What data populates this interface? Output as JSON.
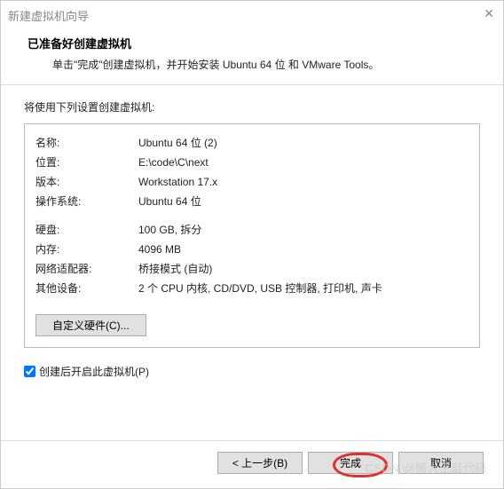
{
  "window": {
    "title": "新建虚拟机向导",
    "close_icon": "✕"
  },
  "header": {
    "title": "已准备好创建虚拟机",
    "subtitle": "单击\"完成\"创建虚拟机，并开始安装 Ubuntu 64 位 和 VMware Tools。"
  },
  "body": {
    "intro": "将使用下列设置创建虚拟机:",
    "group1": [
      {
        "k": "名称:",
        "v": "Ubuntu 64 位 (2)"
      },
      {
        "k": "位置:",
        "v": "E:\\code\\C\\next"
      },
      {
        "k": "版本:",
        "v": "Workstation 17.x"
      },
      {
        "k": "操作系统:",
        "v": "Ubuntu 64 位"
      }
    ],
    "group2": [
      {
        "k": "硬盘:",
        "v": "100 GB, 拆分"
      },
      {
        "k": "内存:",
        "v": "4096 MB"
      },
      {
        "k": "网络适配器:",
        "v": "桥接模式 (自动)"
      },
      {
        "k": "其他设备:",
        "v": "2 个 CPU 内核, CD/DVD, USB 控制器, 打印机, 声卡"
      }
    ],
    "customize_label": "自定义硬件(C)...",
    "checkbox_label": "创建后开启此虚拟机(P)",
    "checkbox_checked": true
  },
  "footer": {
    "back": "< 上一步(B)",
    "finish": "完成",
    "cancel": "取消"
  },
  "watermark": "CSDN @懒大王敲代码"
}
